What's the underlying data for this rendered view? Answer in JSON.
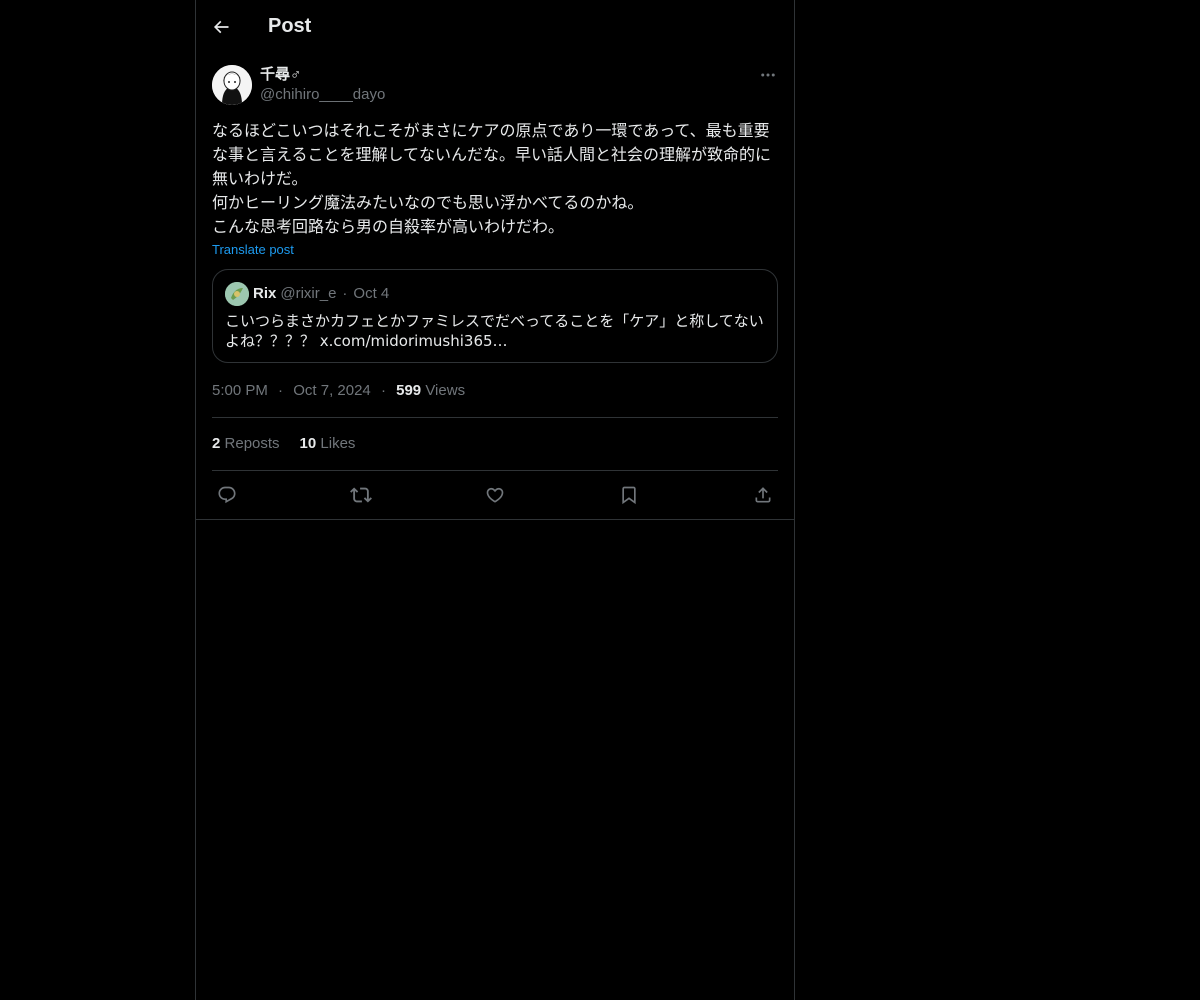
{
  "header": {
    "title": "Post",
    "back_icon": "arrow-left-icon"
  },
  "post": {
    "author": {
      "display_name": "千尋♂",
      "handle": "@chihiro____dayo"
    },
    "text": "なるほどこいつはそれこそがまさにケアの原点であり一環であって、最も重要な事と言えることを理解してないんだな。早い話人間と社会の理解が致命的に無いわけだ。\n何かヒーリング魔法みたいなのでも思い浮かべてるのかね。\nこんな思考回路なら男の自殺率が高いわけだわ。",
    "translate_label": "Translate post",
    "quote": {
      "name": "Rix",
      "handle": "@rixir_e",
      "separator": "·",
      "date": "Oct 4",
      "text": "こいつらまさかカフェとかファミレスでだべってることを「ケア」と称してないよね？？？？ x.com/midorimushi365…"
    },
    "time": "5:00 PM",
    "separator": "·",
    "date": "Oct 7, 2024",
    "views_count": "599",
    "views_label": "Views",
    "reposts_count": "2",
    "reposts_label": "Reposts",
    "likes_count": "10",
    "likes_label": "Likes"
  },
  "actions": {
    "icons": [
      "reply-icon",
      "repost-icon",
      "like-icon",
      "bookmark-icon",
      "share-icon"
    ]
  },
  "colors": {
    "background": "#000000",
    "text": "#e7e9ea",
    "secondary": "#71767b",
    "accent": "#1d9bf0",
    "border": "#2f3336"
  }
}
